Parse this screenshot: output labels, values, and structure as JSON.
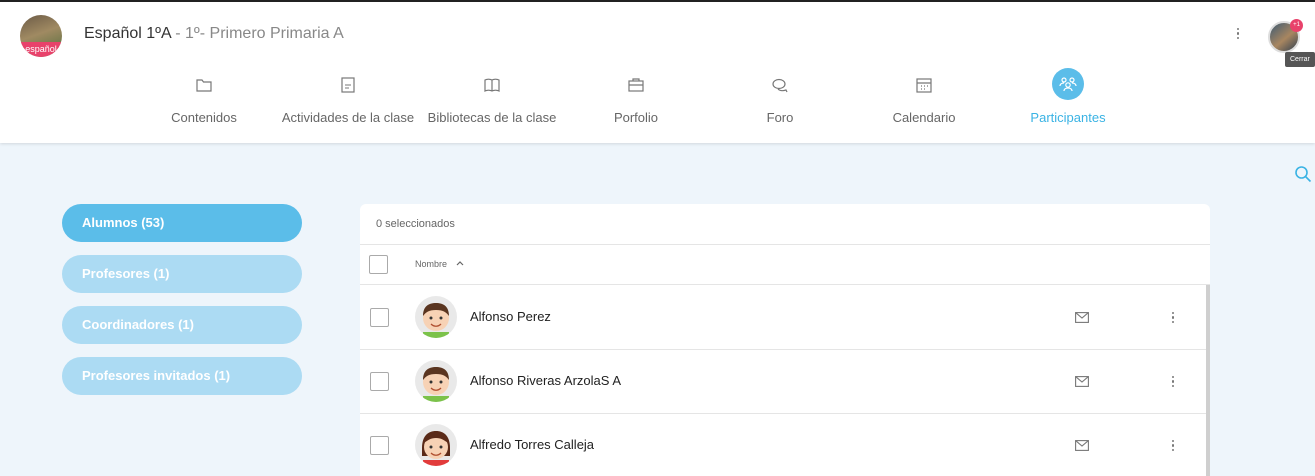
{
  "header": {
    "course": "Español 1ºA",
    "separator": " - ",
    "group": "1º- Primero Primaria A",
    "class_badge": "español",
    "notification_count": "+1",
    "tooltip": "Cerrar"
  },
  "tabs": [
    {
      "label": "Contenidos",
      "icon": "folder-icon"
    },
    {
      "label": "Actividades de la clase",
      "icon": "activity-icon"
    },
    {
      "label": "Bibliotecas de la clase",
      "icon": "book-icon"
    },
    {
      "label": "Porfolio",
      "icon": "briefcase-icon"
    },
    {
      "label": "Foro",
      "icon": "chat-icon"
    },
    {
      "label": "Calendario",
      "icon": "calendar-icon"
    },
    {
      "label": "Participantes",
      "icon": "participants-icon",
      "active": true
    }
  ],
  "sidebar": [
    {
      "label": "Alumnos (53)",
      "active": true
    },
    {
      "label": "Profesores (1)",
      "active": false
    },
    {
      "label": "Coordinadores (1)",
      "active": false
    },
    {
      "label": "Profesores invitados (1)",
      "active": false
    }
  ],
  "list": {
    "selected_count": "0 seleccionados",
    "column_name": "Nombre",
    "rows": [
      {
        "name": "Alfonso Perez",
        "avatar": "boy-avatar"
      },
      {
        "name": "Alfonso Riveras ArzolaS A",
        "avatar": "boy-avatar"
      },
      {
        "name": "Alfredo Torres Calleja",
        "avatar": "girl-avatar"
      }
    ]
  },
  "colors": {
    "accent": "#5bbde9",
    "accent_light": "#acdbf3",
    "accent_text": "#3ab3e4",
    "background": "#eef5fb"
  }
}
